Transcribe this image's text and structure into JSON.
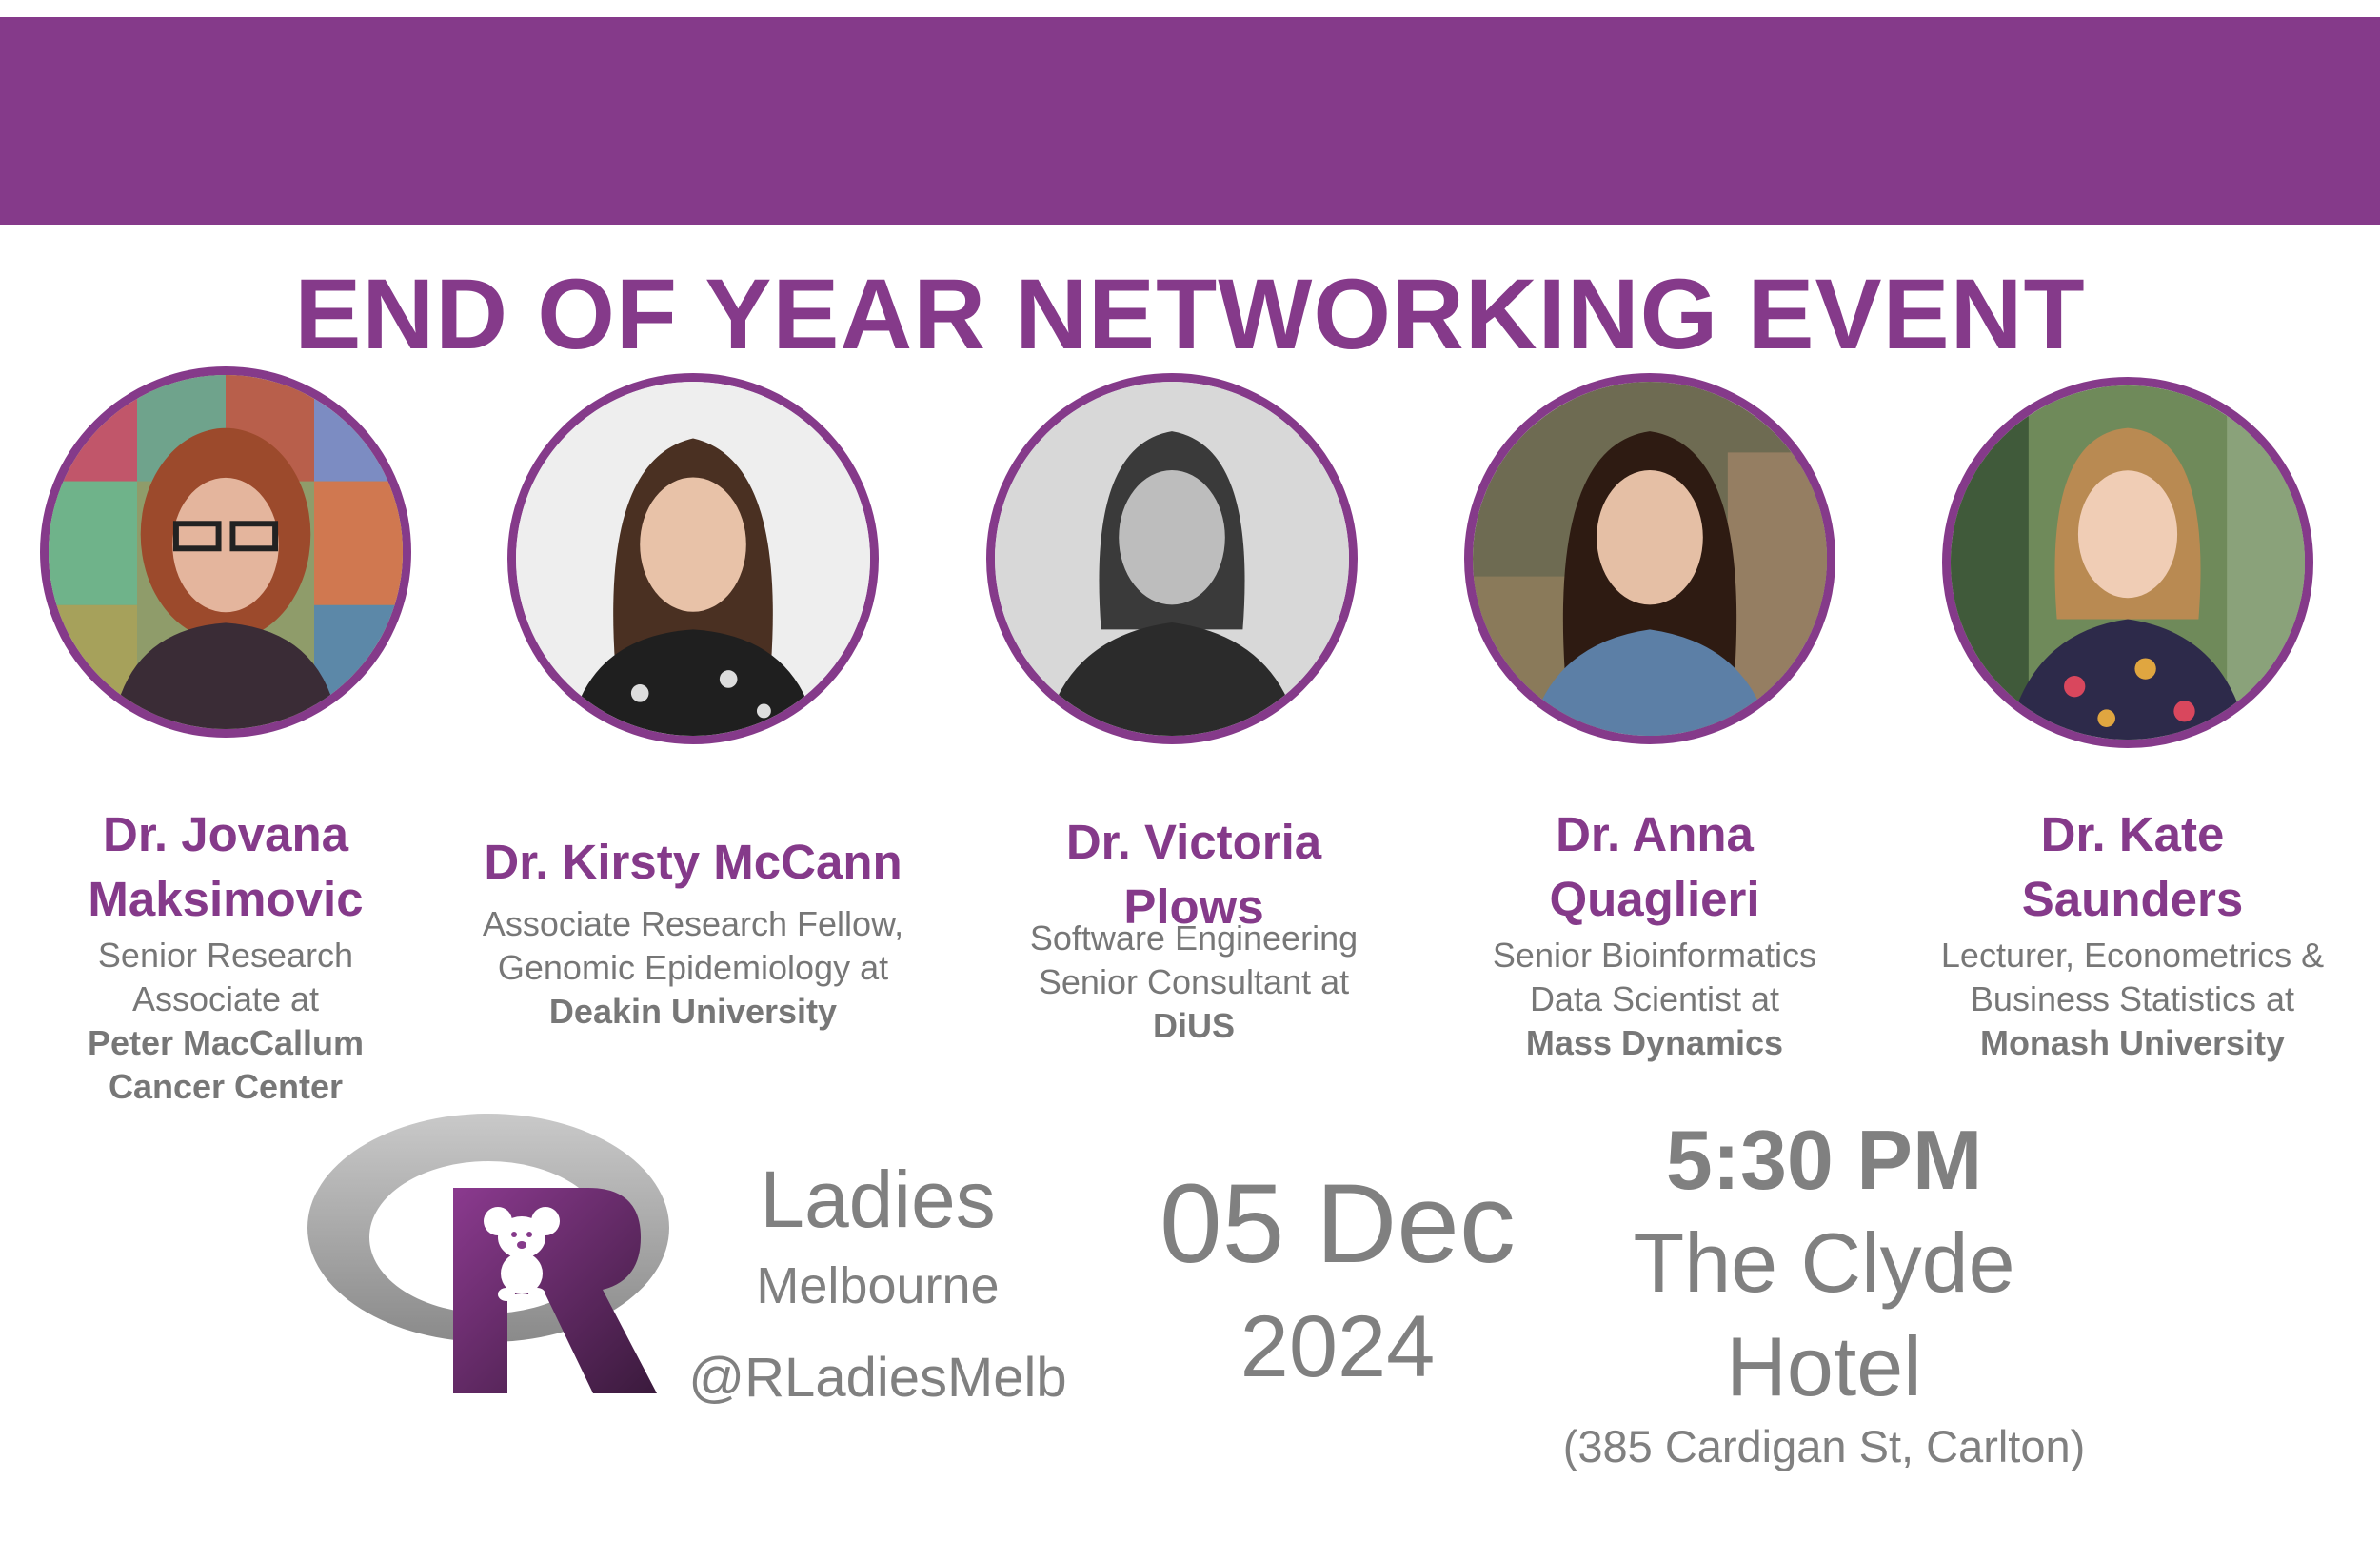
{
  "event": {
    "title": "END OF YEAR NETWORKING EVENT",
    "accent_color": "#853a8a"
  },
  "speakers": [
    {
      "name_line1": "Dr. Jovana",
      "name_line2": "Maksimovic",
      "role": "Senior Research Associate at",
      "org": "Peter MacCallum Cancer Center"
    },
    {
      "name_line1": "Dr. Kirsty McCann",
      "name_line2": "",
      "role": "Associate Research Fellow, Genomic Epidemiology at",
      "org": "Deakin University"
    },
    {
      "name_line1": "Dr. Victoria",
      "name_line2": "Plows",
      "role": "Software Engineering Senior Consultant at",
      "org": "DiUS"
    },
    {
      "name_line1": "Dr. Anna",
      "name_line2": "Quaglieri",
      "role": "Senior Bioinformatics Data Scientist at",
      "org": "Mass Dynamics"
    },
    {
      "name_line1": "Dr. Kate",
      "name_line2": "Saunders",
      "role": "Lecturer, Econometrics & Business Statistics at",
      "org": "Monash University"
    }
  ],
  "branding": {
    "logo_icon": "r-ladies-koala-logo",
    "ladies": "Ladies",
    "city": "Melbourne",
    "handle": "@RLadiesMelb"
  },
  "details": {
    "date": "05 Dec",
    "year": "2024",
    "time": "5:30 PM",
    "venue_line1": "The Clyde",
    "venue_line2": "Hotel",
    "address": "(385 Cardigan St, Carlton)"
  }
}
